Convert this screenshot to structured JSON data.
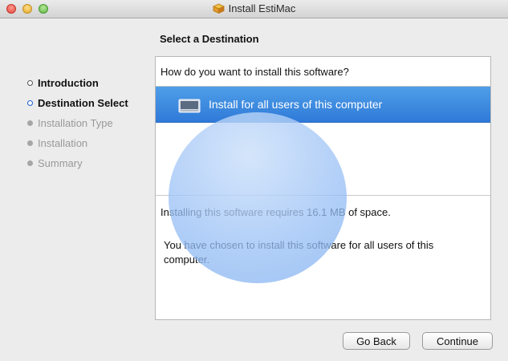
{
  "window": {
    "title": "Install EstiMac",
    "icon": "package-icon"
  },
  "page": {
    "heading": "Select a Destination"
  },
  "sidebar": {
    "steps": [
      {
        "label": "Introduction",
        "state": "done"
      },
      {
        "label": "Destination Select",
        "state": "current"
      },
      {
        "label": "Installation Type",
        "state": "future"
      },
      {
        "label": "Installation",
        "state": "future"
      },
      {
        "label": "Summary",
        "state": "future"
      }
    ]
  },
  "destination": {
    "question": "How do you want to install this software?",
    "options": [
      {
        "label": "Install for all users of this computer",
        "icon": "disk-icon",
        "selected": true
      }
    ],
    "space_text": "Installing this software requires 16.1 MB of space.",
    "choice_text": "You have chosen to install this software for all users of this computer."
  },
  "buttons": {
    "back": "Go Back",
    "continue": "Continue"
  },
  "colors": {
    "selection": "#3a87e0",
    "window_bg": "#ececec"
  }
}
